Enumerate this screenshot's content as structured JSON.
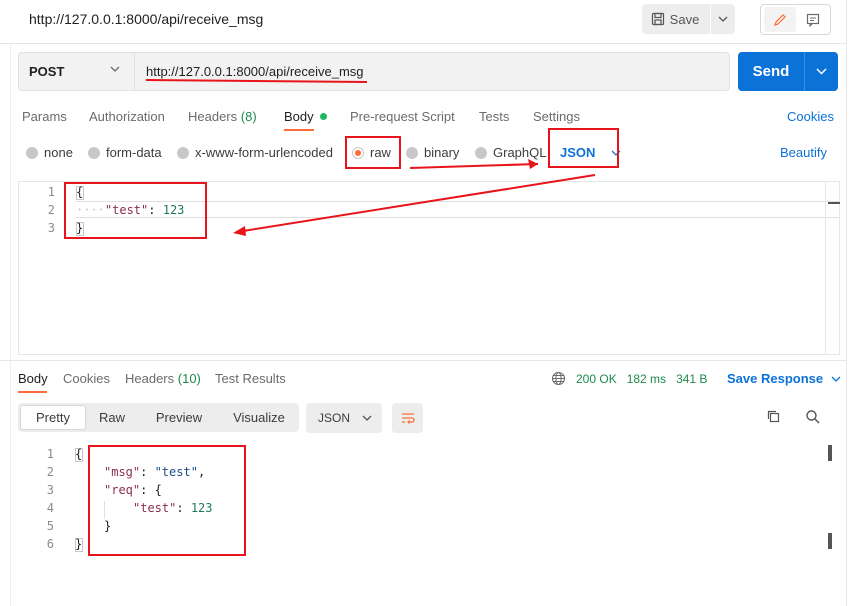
{
  "window": {
    "url_title": "http://127.0.0.1:8000/api/receive_msg"
  },
  "toolbar": {
    "save_label": "Save"
  },
  "request": {
    "method": "POST",
    "url": "http://127.0.0.1:8000/api/receive_msg",
    "send_label": "Send",
    "tabs": [
      {
        "label": "Params"
      },
      {
        "label": "Authorization"
      },
      {
        "label": "Headers",
        "count": "(8)"
      },
      {
        "label": "Body"
      },
      {
        "label": "Pre-request Script"
      },
      {
        "label": "Tests"
      },
      {
        "label": "Settings"
      }
    ],
    "cookies_label": "Cookies",
    "body_types": [
      {
        "label": "none"
      },
      {
        "label": "form-data"
      },
      {
        "label": "x-www-form-urlencoded"
      },
      {
        "label": "raw"
      },
      {
        "label": "binary"
      },
      {
        "label": "GraphQL"
      }
    ],
    "body_format": "JSON",
    "beautify_label": "Beautify",
    "body_lines": [
      {
        "n": "1",
        "text": "{"
      },
      {
        "n": "2",
        "key": "\"test\"",
        "sep": ": ",
        "value": "123",
        "indent": "····"
      },
      {
        "n": "3",
        "text": "}"
      }
    ]
  },
  "response": {
    "tabs": [
      {
        "label": "Body"
      },
      {
        "label": "Cookies"
      },
      {
        "label": "Headers",
        "count": "(10)"
      },
      {
        "label": "Test Results"
      }
    ],
    "status": "200 OK",
    "time": "182 ms",
    "size": "341 B",
    "save_response_label": "Save Response",
    "view_modes": [
      {
        "label": "Pretty"
      },
      {
        "label": "Raw"
      },
      {
        "label": "Preview"
      },
      {
        "label": "Visualize"
      }
    ],
    "format": "JSON",
    "body_lines": [
      {
        "n": "1",
        "text": "{"
      },
      {
        "n": "2",
        "key": "\"msg\"",
        "sep": ": ",
        "value": "\"test\"",
        "tail": ","
      },
      {
        "n": "3",
        "key": "\"req\"",
        "sep": ": ",
        "tail": "{"
      },
      {
        "n": "4",
        "key": "\"test\"",
        "sep": ": ",
        "value": "123"
      },
      {
        "n": "5",
        "text": "}"
      },
      {
        "n": "6",
        "text": "}"
      }
    ]
  },
  "colors": {
    "accent": "#ff6c37",
    "primary": "#0b72d8",
    "annotation": "#e8141b",
    "success": "#1f8a4c"
  },
  "icons": [
    "save-icon",
    "chevron-down-icon",
    "pencil-icon",
    "comment-icon",
    "globe-icon",
    "wrap-lines-icon",
    "copy-icon",
    "search-icon"
  ]
}
